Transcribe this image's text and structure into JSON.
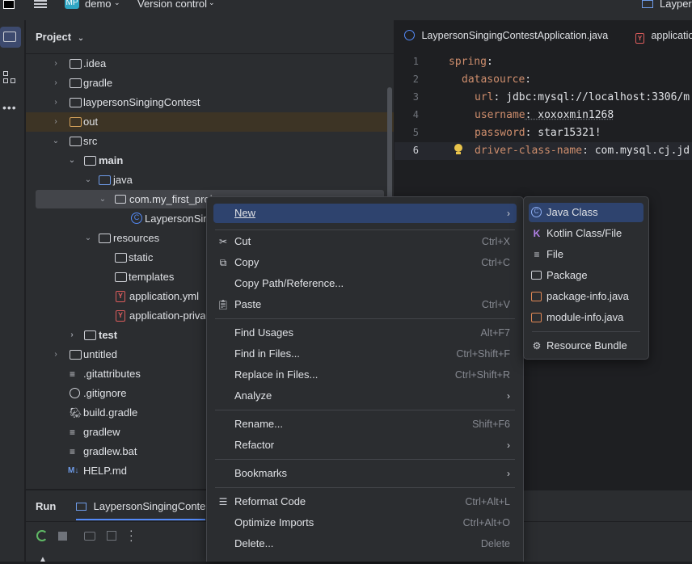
{
  "window": {
    "project_badge": "MP",
    "project_name": "demo",
    "vcs_menu": "Version control",
    "right_title": "Laypers"
  },
  "project_panel": {
    "title": "Project",
    "tree": [
      {
        "label": ".idea",
        "kind": "folder"
      },
      {
        "label": "gradle",
        "kind": "folder"
      },
      {
        "label": "laypersonSingingContest",
        "kind": "folder"
      },
      {
        "label": "out",
        "kind": "folder"
      },
      {
        "label": "src",
        "kind": "folder"
      },
      {
        "label": "main",
        "kind": "folder"
      },
      {
        "label": "java",
        "kind": "folder"
      },
      {
        "label": "com.my_first_proj",
        "kind": "package"
      },
      {
        "label": "LaypersonSing",
        "kind": "class"
      },
      {
        "label": "resources",
        "kind": "folder"
      },
      {
        "label": "static",
        "kind": "folder"
      },
      {
        "label": "templates",
        "kind": "folder"
      },
      {
        "label": "application.yml",
        "kind": "yaml"
      },
      {
        "label": "application-privat",
        "kind": "yaml"
      },
      {
        "label": "test",
        "kind": "folder"
      },
      {
        "label": "untitled",
        "kind": "folder"
      },
      {
        "label": ".gitattributes",
        "kind": "file"
      },
      {
        "label": ".gitignore",
        "kind": "file"
      },
      {
        "label": "build.gradle",
        "kind": "gradle"
      },
      {
        "label": "gradlew",
        "kind": "file"
      },
      {
        "label": "gradlew.bat",
        "kind": "file"
      },
      {
        "label": "HELP.md",
        "kind": "md"
      }
    ]
  },
  "editor": {
    "tabs": [
      "LaypersonSingingContestApplication.java",
      "applicatio"
    ],
    "lines": [
      {
        "num": "1",
        "key": "spring",
        "rest": ":"
      },
      {
        "num": "2",
        "key": "datasource",
        "rest": ":"
      },
      {
        "num": "3",
        "key": "url",
        "rest": ": jdbc:mysql://localhost:3306/m"
      },
      {
        "num": "4",
        "key": "username",
        "rest": ": xoxoxmin1268"
      },
      {
        "num": "5",
        "key": "password",
        "rest": ": star15321!"
      },
      {
        "num": "6",
        "key": "driver-class-name",
        "rest": ": com.mysql.cj.jd"
      }
    ]
  },
  "run_panel": {
    "title": "Run",
    "tab": "LaypersonSingingContestA"
  },
  "context_menu": {
    "items": [
      {
        "label": "New",
        "shortcut": "",
        "submenu": true,
        "icon": ""
      },
      {
        "label": "Cut",
        "shortcut": "Ctrl+X",
        "icon": "scissors-icon"
      },
      {
        "label": "Copy",
        "shortcut": "Ctrl+C",
        "icon": "copy-icon"
      },
      {
        "label": "Copy Path/Reference...",
        "shortcut": "",
        "icon": ""
      },
      {
        "label": "Paste",
        "shortcut": "Ctrl+V",
        "icon": "paste-icon"
      },
      {
        "label": "Find Usages",
        "shortcut": "Alt+F7",
        "icon": ""
      },
      {
        "label": "Find in Files...",
        "shortcut": "Ctrl+Shift+F",
        "icon": ""
      },
      {
        "label": "Replace in Files...",
        "shortcut": "Ctrl+Shift+R",
        "icon": ""
      },
      {
        "label": "Analyze",
        "shortcut": "",
        "submenu": true,
        "icon": ""
      },
      {
        "label": "Rename...",
        "shortcut": "Shift+F6",
        "icon": ""
      },
      {
        "label": "Refactor",
        "shortcut": "",
        "submenu": true,
        "icon": ""
      },
      {
        "label": "Bookmarks",
        "shortcut": "",
        "submenu": true,
        "icon": ""
      },
      {
        "label": "Reformat Code",
        "shortcut": "Ctrl+Alt+L",
        "icon": "reformat-icon"
      },
      {
        "label": "Optimize Imports",
        "shortcut": "Ctrl+Alt+O",
        "icon": ""
      },
      {
        "label": "Delete...",
        "shortcut": "Delete",
        "icon": ""
      }
    ]
  },
  "new_submenu": {
    "items": [
      {
        "label": "Java Class",
        "icon": "java-class-icon"
      },
      {
        "label": "Kotlin Class/File",
        "icon": "kotlin-icon"
      },
      {
        "label": "File",
        "icon": "file-icon"
      },
      {
        "label": "Package",
        "icon": "package-icon"
      },
      {
        "label": "package-info.java",
        "icon": "java-file-icon"
      },
      {
        "label": "module-info.java",
        "icon": "java-file-icon"
      },
      {
        "label": "Resource Bundle",
        "icon": "resource-bundle-icon"
      }
    ]
  },
  "colors": {
    "accent": "#2e436e",
    "yaml_key": "#cf8e6d",
    "folder_blue": "#6e9be8",
    "yaml_icon": "#db5c5c"
  }
}
